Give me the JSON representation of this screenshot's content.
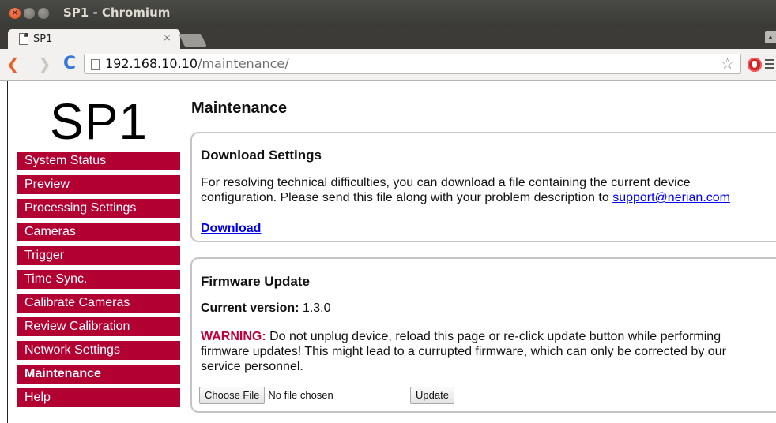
{
  "window": {
    "title": "SP1 - Chromium",
    "close_glyph": "×",
    "min_glyph": "–",
    "max_glyph": "□"
  },
  "tab": {
    "title": "SP1",
    "close_glyph": "×"
  },
  "toolbar": {
    "back_glyph": "❮",
    "forward_glyph": "❯",
    "reload_glyph": "C",
    "url_host": "192.168.10.10",
    "url_path": "/maintenance/",
    "star_glyph": "☆"
  },
  "sidebar": {
    "logo": "SP1",
    "items": [
      {
        "label": "System Status",
        "active": false
      },
      {
        "label": "Preview",
        "active": false
      },
      {
        "label": "Processing Settings",
        "active": false
      },
      {
        "label": "Cameras",
        "active": false
      },
      {
        "label": "Trigger",
        "active": false
      },
      {
        "label": "Time Sync.",
        "active": false
      },
      {
        "label": "Calibrate Cameras",
        "active": false
      },
      {
        "label": "Review Calibration",
        "active": false
      },
      {
        "label": "Network Settings",
        "active": false
      },
      {
        "label": "Maintenance",
        "active": true
      },
      {
        "label": "Help",
        "active": false
      }
    ],
    "item_color": "#b30033"
  },
  "main": {
    "title": "Maintenance",
    "download": {
      "title": "Download Settings",
      "text": "For resolving technical difficulties, you can download a file containing the current device configuration. Please send this file along with your problem description to ",
      "email": "support@nerian.com",
      "link_label": "Download"
    },
    "firmware": {
      "title": "Firmware Update",
      "version_label": "Current version:",
      "version_value": "1.3.0",
      "warning_label": "WARNING:",
      "warning_text": " Do not unplug device, reload this page or re-click update button while performing firmware updates! This might lead to a currupted firmware, which can only be corrected by our service personnel.",
      "choose_file_label": "Choose File",
      "no_file_text": "No file chosen",
      "update_label": "Update"
    }
  }
}
